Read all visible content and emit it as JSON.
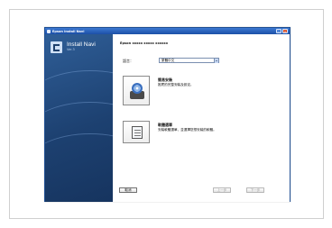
{
  "window": {
    "title": "Epson Install Navi",
    "minimize_label": "–",
    "close_label": "×"
  },
  "sidebar": {
    "title": "Install Navi",
    "version": "Ver.3"
  },
  "header": {
    "product": "Epson xxxxx xxxxx xxxxxx"
  },
  "language": {
    "label": "語言：",
    "selected": "繁體中文"
  },
  "options": [
    {
      "title": "簡易安裝",
      "description": "推薦的完整安裝及設定。",
      "icon": "install-disc-icon"
    },
    {
      "title": "軟體選單",
      "description": "安裝軟體選單，並選擇您想安裝的軟體。",
      "icon": "software-list-icon"
    }
  ],
  "buttons": {
    "cancel": "取消",
    "back": "上一步",
    "next": "下一步"
  },
  "colors": {
    "titlebar": "#2a5db4",
    "sidebar": "#1d4171",
    "close": "#d9522b"
  }
}
